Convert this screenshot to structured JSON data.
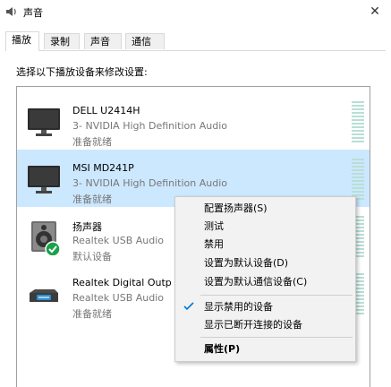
{
  "window": {
    "title": "声音"
  },
  "tabs": [
    {
      "label": "播放",
      "active": true
    },
    {
      "label": "录制",
      "active": false
    },
    {
      "label": "声音",
      "active": false
    },
    {
      "label": "通信",
      "active": false
    }
  ],
  "instruction": "选择以下播放设备来修改设置:",
  "devices": [
    {
      "name": "DELL U2414H",
      "sub": "3- NVIDIA High Definition Audio",
      "status": "准备就绪",
      "icon": "monitor-icon",
      "selected": false
    },
    {
      "name": "MSI MD241P",
      "sub": "3- NVIDIA High Definition Audio",
      "status": "准备就绪",
      "icon": "monitor-icon",
      "selected": true
    },
    {
      "name": "扬声器",
      "sub": "Realtek USB Audio",
      "status": "默认设备",
      "icon": "speaker-icon",
      "selected": false,
      "default": true
    },
    {
      "name": "Realtek Digital Outp",
      "sub": "Realtek USB Audio",
      "status": "准备就绪",
      "icon": "digital-output-icon",
      "selected": false
    }
  ],
  "context_menu": {
    "items": [
      {
        "label": "配置扬声器(S)"
      },
      {
        "label": "测试"
      },
      {
        "label": "禁用"
      },
      {
        "label": "设置为默认设备(D)"
      },
      {
        "label": "设置为默认通信设备(C)"
      },
      {
        "label": "显示禁用的设备",
        "checked": true
      },
      {
        "label": "显示已断开连接的设备"
      },
      {
        "label": "属性(P)",
        "bold": true
      }
    ]
  },
  "colors": {
    "selection": "#cce8ff",
    "default_badge": "#1aa14a",
    "check": "#0078d7"
  }
}
